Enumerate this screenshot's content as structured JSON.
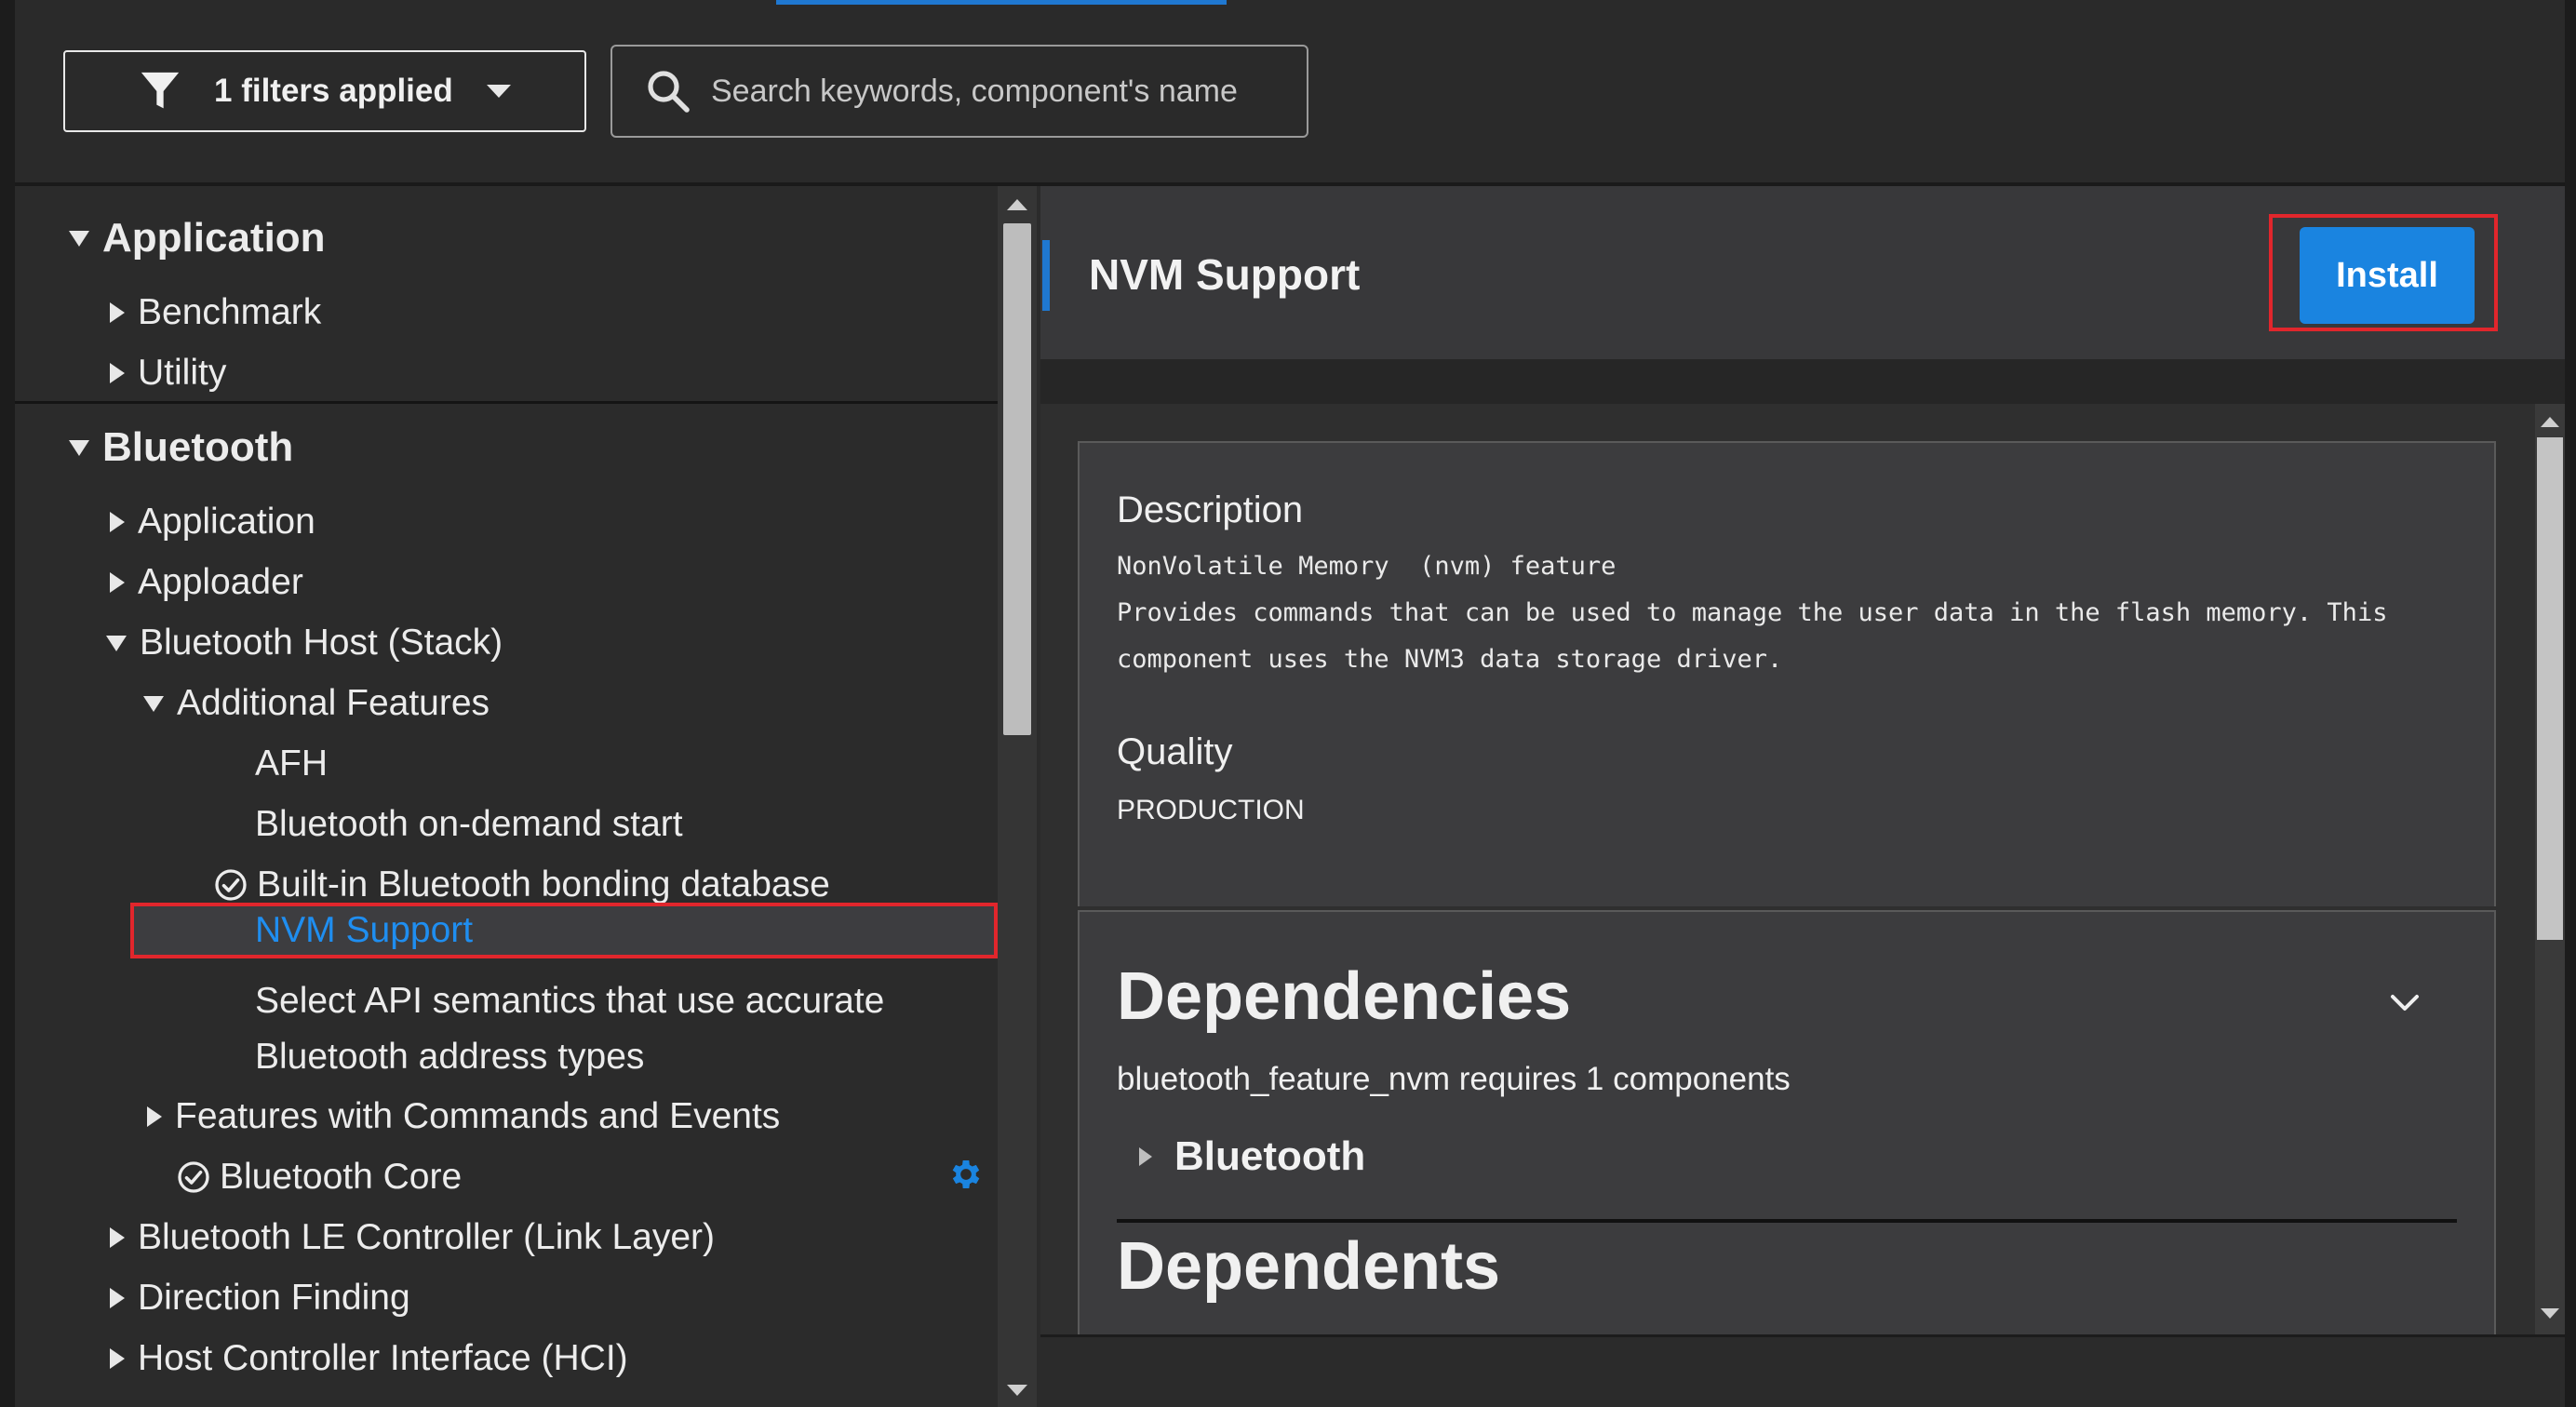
{
  "filter": {
    "label": "1 filters applied"
  },
  "search": {
    "placeholder": "Search keywords, component's name"
  },
  "tree": {
    "application": {
      "label": "Application",
      "children": [
        "Benchmark",
        "Utility"
      ]
    },
    "bluetooth": {
      "label": "Bluetooth",
      "application": "Application",
      "apploader": "Apploader",
      "host_stack": "Bluetooth Host (Stack)",
      "additional_features": "Additional Features",
      "afh": "AFH",
      "on_demand_start": "Bluetooth on-demand start",
      "bonding_db": "Built-in Bluetooth bonding database",
      "nvm_support": "NVM Support",
      "select_api_line1": "Select API semantics that use accurate",
      "select_api_line2": "Bluetooth address types",
      "features_commands": "Features with Commands and Events",
      "bluetooth_core": "Bluetooth Core",
      "le_controller": "Bluetooth LE Controller (Link Layer)",
      "direction_finding": "Direction Finding",
      "hci": "Host Controller Interface (HCI)"
    }
  },
  "component": {
    "title": "NVM Support",
    "install_label": "Install",
    "description_label": "Description",
    "description_text": "NonVolatile Memory  (nvm) feature\nProvides commands that can be used to manage the user data in the flash memory. This\ncomponent uses the NVM3 data storage driver.",
    "quality_label": "Quality",
    "quality_value": "PRODUCTION",
    "dependencies_label": "Dependencies",
    "dependencies_info": "bluetooth_feature_nvm requires 1 components",
    "dependency_group": "Bluetooth",
    "dependents_label": "Dependents"
  },
  "colors": {
    "accent": "#1f78d1",
    "selected_text": "#1f8ef0",
    "highlight_outline": "#e1262c",
    "install_button": "#1a84e0"
  }
}
